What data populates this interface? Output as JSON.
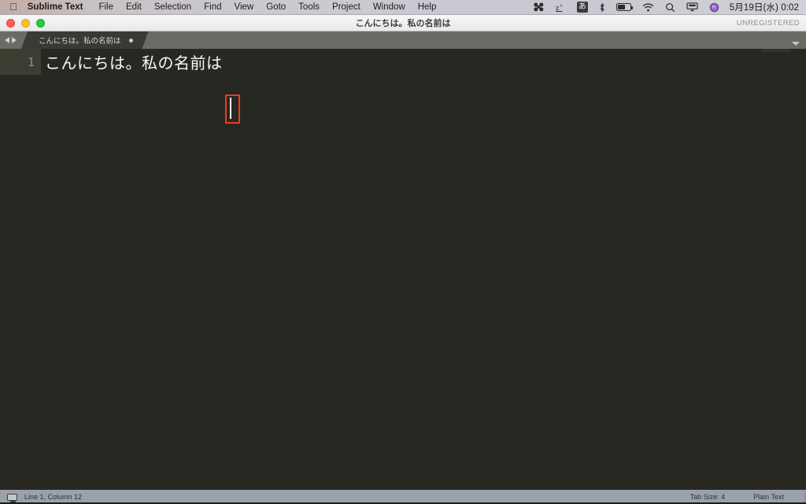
{
  "menubar": {
    "apple_icon": "apple-logo-icon",
    "app_name": "Sublime Text",
    "items": [
      "File",
      "Edit",
      "Selection",
      "Find",
      "View",
      "Goto",
      "Tools",
      "Project",
      "Window",
      "Help"
    ],
    "status_icons": [
      "dropbox-icon",
      "sleep-icon",
      "input-method-icon",
      "bluetooth-icon",
      "battery-icon",
      "wifi-icon",
      "search-icon",
      "airplay-icon",
      "siri-icon"
    ],
    "ime_label": "あ",
    "clock": "5月19日(水)  0:02"
  },
  "window": {
    "title": "こんにちは。私の名前は",
    "license_status": "UNREGISTERED",
    "traffic_lights": [
      "close-button",
      "minimize-button",
      "zoom-button"
    ]
  },
  "tabbar": {
    "nav_back_icon": "nav-back-arrow-icon",
    "nav_forward_icon": "nav-forward-arrow-icon",
    "tabs": [
      {
        "label": "こんにちは。私の名前は",
        "dirty": true
      }
    ],
    "dropdown_icon": "chevron-down-icon"
  },
  "editor": {
    "line_number": "1",
    "line_text": "こんにちは。私の名前は",
    "caret_visible": true,
    "annotation": {
      "type": "highlight-rectangle",
      "color": "#ef3a22"
    }
  },
  "statusbar": {
    "left_icon": "display-icon",
    "cursor_position": "Line 1, Column 12",
    "tab_size": "Tab Size: 4",
    "syntax": "Plain Text"
  },
  "colors": {
    "editor_background": "#272822",
    "gutter_active": "#3e3d32",
    "tabbar_background": "#6b6b66",
    "tab_active": "#3a3a35",
    "statusbar_background": "#9ba0ab",
    "annotation": "#ef3a22"
  }
}
